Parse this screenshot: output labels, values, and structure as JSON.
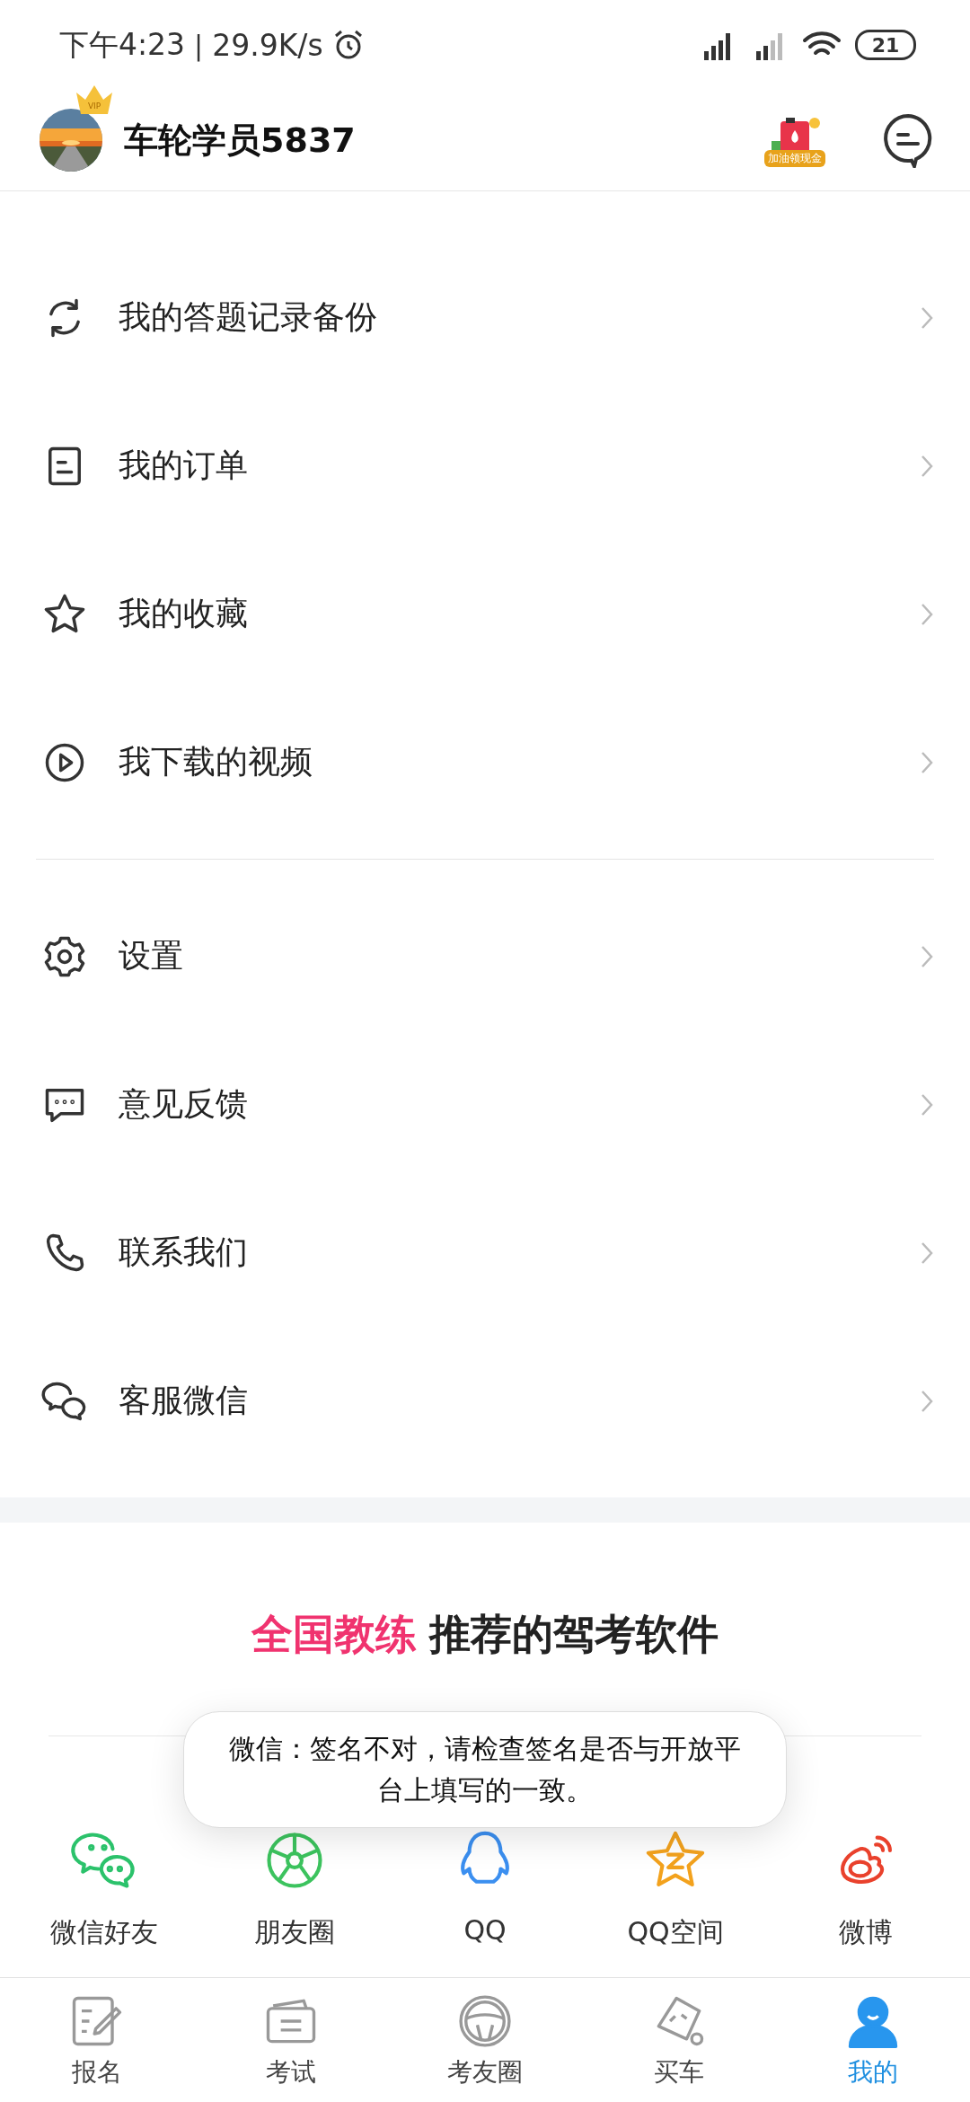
{
  "status_bar": {
    "time": "下午4:23",
    "separator": "|",
    "speed": "29.9K/s",
    "battery": "21"
  },
  "header": {
    "vip_badge": "VIP",
    "username": "车轮学员5837",
    "promo_text": "加油领现金"
  },
  "menu_groups": [
    {
      "items": [
        {
          "label": "我的答题记录备份"
        },
        {
          "label": "我的订单"
        },
        {
          "label": "我的收藏"
        },
        {
          "label": "我下载的视频"
        }
      ]
    },
    {
      "items": [
        {
          "label": "设置"
        },
        {
          "label": "意见反馈"
        },
        {
          "label": "联系我们"
        },
        {
          "label": "客服微信"
        }
      ]
    }
  ],
  "promo": {
    "highlight": "全国教练",
    "rest": "推荐的驾考软件"
  },
  "share_targets": [
    {
      "label": "微信好友"
    },
    {
      "label": "朋友圈"
    },
    {
      "label": "QQ"
    },
    {
      "label": "QQ空间"
    },
    {
      "label": "微博"
    }
  ],
  "toast": "微信：签名不对，请检查签名是否与开放平台上填写的一致。",
  "tab_bar": [
    {
      "label": "报名",
      "selected": false
    },
    {
      "label": "考试",
      "selected": false
    },
    {
      "label": "考友圈",
      "selected": false
    },
    {
      "label": "买车",
      "selected": false
    },
    {
      "label": "我的",
      "selected": true
    }
  ]
}
